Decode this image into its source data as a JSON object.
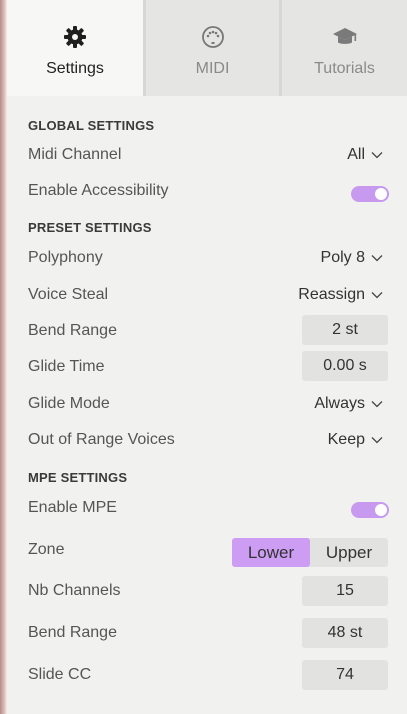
{
  "tabs": [
    {
      "label": "Settings",
      "icon": "gear-icon",
      "active": true
    },
    {
      "label": "MIDI",
      "icon": "midi-connector-icon",
      "active": false
    },
    {
      "label": "Tutorials",
      "icon": "graduation-cap-icon",
      "active": false
    }
  ],
  "global": {
    "title": "GLOBAL SETTINGS",
    "midi_channel_label": "Midi Channel",
    "midi_channel_value": "All",
    "accessibility_label": "Enable Accessibility",
    "accessibility_on": true
  },
  "preset": {
    "title": "PRESET SETTINGS",
    "polyphony_label": "Polyphony",
    "polyphony_value": "Poly 8",
    "voice_steal_label": "Voice Steal",
    "voice_steal_value": "Reassign",
    "bend_range_label": "Bend Range",
    "bend_range_value": "2 st",
    "glide_time_label": "Glide Time",
    "glide_time_value": "0.00 s",
    "glide_mode_label": "Glide Mode",
    "glide_mode_value": "Always",
    "out_of_range_label": "Out of Range Voices",
    "out_of_range_value": "Keep"
  },
  "mpe": {
    "title": "MPE SETTINGS",
    "enable_label": "Enable MPE",
    "enable_on": true,
    "zone_label": "Zone",
    "zone_options": [
      "Lower",
      "Upper"
    ],
    "zone_selected": "Lower",
    "nb_channels_label": "Nb Channels",
    "nb_channels_value": "15",
    "bend_range_label": "Bend Range",
    "bend_range_value": "48 st",
    "slide_cc_label": "Slide CC",
    "slide_cc_value": "74"
  },
  "colors": {
    "accent": "#c79af0",
    "panel_bg": "#f1f1ef",
    "value_box_bg": "#e2e2e0"
  }
}
